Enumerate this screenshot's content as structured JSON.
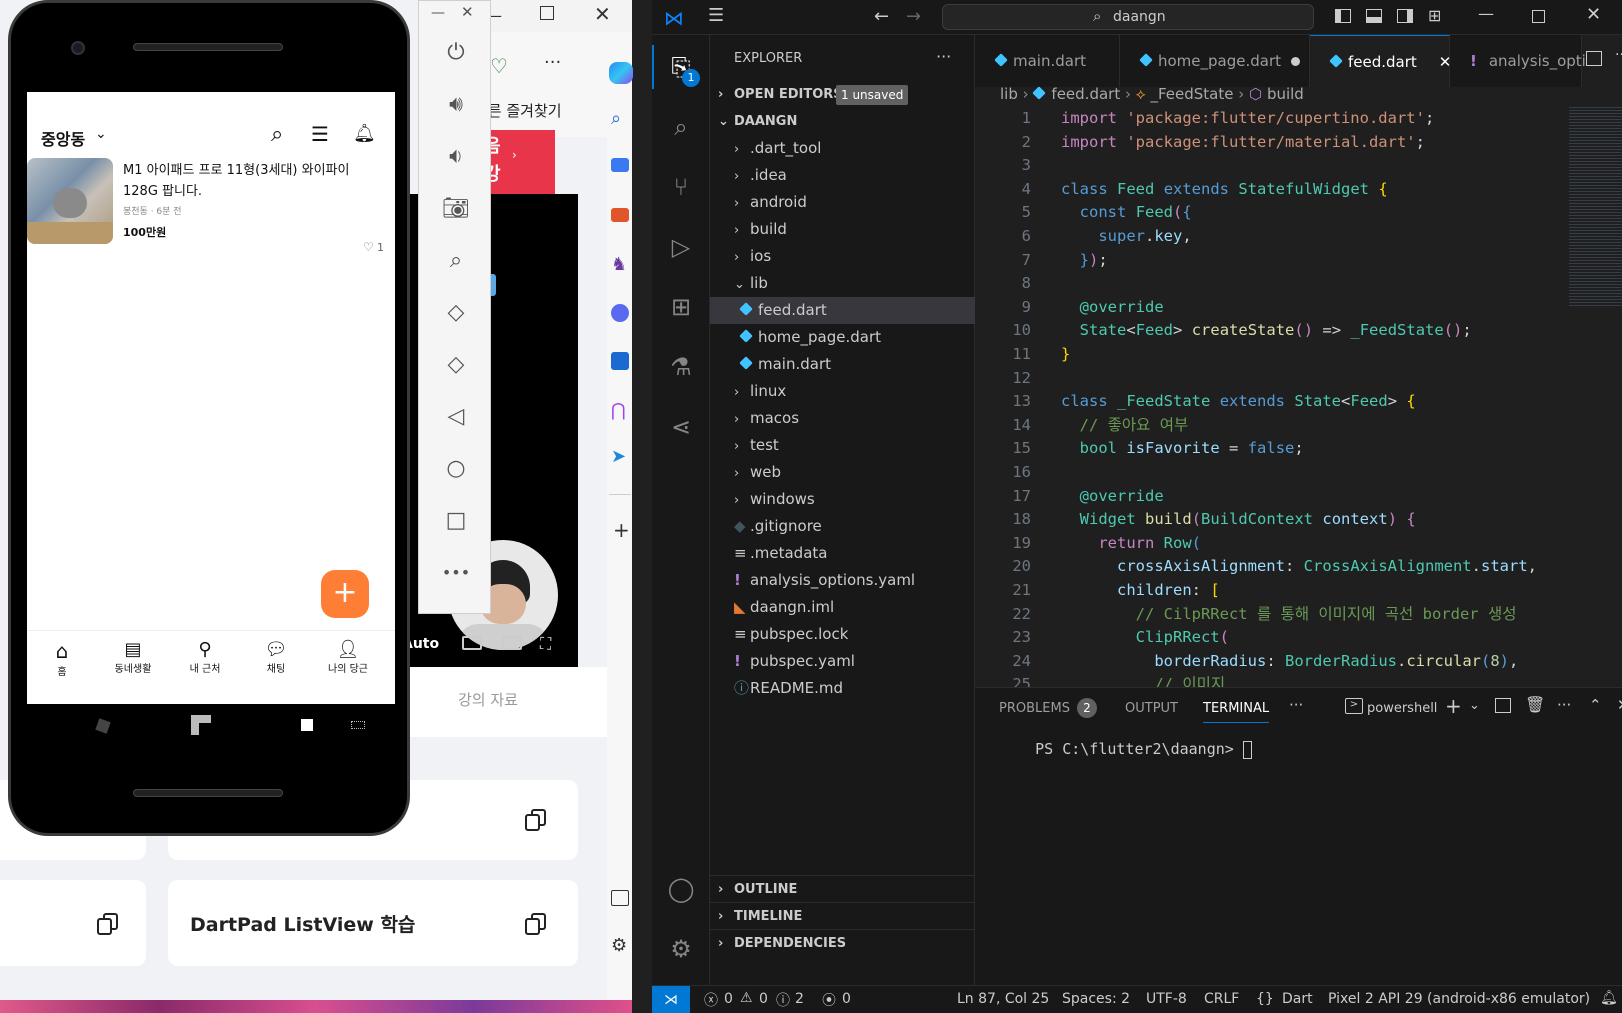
{
  "browser": {
    "favorites_text": "다른 즐겨찾기",
    "banner_top": "음",
    "banner_bottom": "강",
    "video_auto": "Auto",
    "course_materials": "강의 자료",
    "card_dartpad": "DartPad ListView 학습",
    "more_label": "···"
  },
  "phone": {
    "location": "중앙동",
    "item": {
      "title": "M1 아이패드 프로 11형(3세대) 와이파이 128G 팝니다.",
      "meta": "봉천동 · 6분 전",
      "price": "100만원",
      "likes": "1"
    },
    "fab": "+",
    "nav": [
      {
        "label": "홈"
      },
      {
        "label": "동네생활"
      },
      {
        "label": "내 근처"
      },
      {
        "label": "채팅"
      },
      {
        "label": "나의 당근"
      }
    ]
  },
  "emulator_toolbar": [
    "power",
    "volume-up",
    "volume-down",
    "camera",
    "zoom",
    "rotate-left",
    "rotate-right",
    "back",
    "home",
    "overview",
    "more"
  ],
  "vscode": {
    "search": "daangn",
    "explorer_title": "EXPLORER",
    "open_editors": "OPEN EDITORS",
    "unsaved_badge": "1 unsaved",
    "project": "DAANGN",
    "tree": [
      {
        "name": ".dart_tool",
        "type": "folder",
        "depth": 1
      },
      {
        "name": ".idea",
        "type": "folder",
        "depth": 1
      },
      {
        "name": "android",
        "type": "folder",
        "depth": 1
      },
      {
        "name": "build",
        "type": "folder",
        "depth": 1
      },
      {
        "name": "ios",
        "type": "folder",
        "depth": 1
      },
      {
        "name": "lib",
        "type": "folder-open",
        "depth": 1
      },
      {
        "name": "feed.dart",
        "type": "dart",
        "depth": 2
      },
      {
        "name": "home_page.dart",
        "type": "dart",
        "depth": 2
      },
      {
        "name": "main.dart",
        "type": "dart",
        "depth": 2
      },
      {
        "name": "linux",
        "type": "folder",
        "depth": 1
      },
      {
        "name": "macos",
        "type": "folder",
        "depth": 1
      },
      {
        "name": "test",
        "type": "folder",
        "depth": 1
      },
      {
        "name": "web",
        "type": "folder",
        "depth": 1
      },
      {
        "name": "windows",
        "type": "folder",
        "depth": 1
      },
      {
        "name": ".gitignore",
        "type": "git",
        "depth": 1
      },
      {
        "name": ".metadata",
        "type": "lines",
        "depth": 1
      },
      {
        "name": "analysis_options.yaml",
        "type": "yaml",
        "depth": 1
      },
      {
        "name": "daangn.iml",
        "type": "rss",
        "depth": 1
      },
      {
        "name": "pubspec.lock",
        "type": "lines",
        "depth": 1
      },
      {
        "name": "pubspec.yaml",
        "type": "yaml",
        "depth": 1
      },
      {
        "name": "README.md",
        "type": "info",
        "depth": 1
      }
    ],
    "outline": "OUTLINE",
    "timeline": "TIMELINE",
    "dependencies": "DEPENDENCIES",
    "tabs": [
      {
        "label": "main.dart"
      },
      {
        "label": "home_page.dart"
      },
      {
        "label": "feed.dart"
      },
      {
        "label": "analysis_opti"
      }
    ],
    "breadcrumb": [
      "lib",
      "feed.dart",
      "_FeedState",
      "build"
    ],
    "code_lines": [
      {
        "n": "1",
        "html": "<span class='p'>import</span> <span class='s'>'package:flutter/cupertino.dart'</span><span class='w'>;</span>"
      },
      {
        "n": "2",
        "html": "<span class='p'>import</span> <span class='s'>'package:flutter/material.dart'</span><span class='w'>;</span>"
      },
      {
        "n": "3",
        "html": ""
      },
      {
        "n": "4",
        "html": "<span class='k'>class</span> <span class='t'>Feed</span> <span class='k'>extends</span> <span class='t'>StatefulWidget</span> <span class='y'>{</span>"
      },
      {
        "n": "5",
        "html": "  <span class='k'>const</span> <span class='t'>Feed</span><span class='p'>(</span><span class='k'>{</span>"
      },
      {
        "n": "6",
        "html": "    <span class='k'>super</span><span class='w'>.</span><span class='v'>key</span><span class='w'>,</span>"
      },
      {
        "n": "7",
        "html": "  <span class='k'>}</span><span class='p'>)</span><span class='w'>;</span>"
      },
      {
        "n": "8",
        "html": ""
      },
      {
        "n": "9",
        "html": "  <span class='t'>@override</span>"
      },
      {
        "n": "10",
        "html": "  <span class='t'>State</span><span class='w'>&lt;</span><span class='t'>Feed</span><span class='w'>&gt;</span> <span class='f'>createState</span><span class='p'>()</span> <span class='w'>=&gt;</span> <span class='t'>_FeedState</span><span class='p'>()</span><span class='w'>;</span>"
      },
      {
        "n": "11",
        "html": "<span class='y'>}</span>"
      },
      {
        "n": "12",
        "html": ""
      },
      {
        "n": "13",
        "html": "<span class='k'>class</span> <span class='t'>_FeedState</span> <span class='k'>extends</span> <span class='t'>State</span><span class='w'>&lt;</span><span class='t'>Feed</span><span class='w'>&gt;</span> <span class='y'>{</span>"
      },
      {
        "n": "14",
        "html": "  <span class='c'>// 좋아요 여부</span>"
      },
      {
        "n": "15",
        "html": "  <span class='t'>bool</span> <span class='v'>isFavorite</span> <span class='w'>=</span> <span class='k'>false</span><span class='w'>;</span>"
      },
      {
        "n": "16",
        "html": ""
      },
      {
        "n": "17",
        "html": "  <span class='t'>@override</span>"
      },
      {
        "n": "18",
        "html": "  <span class='t'>Widget</span> <span class='f'>build</span><span class='p'>(</span><span class='t'>BuildContext</span> <span class='v'>context</span><span class='p'>)</span> <span class='p'>{</span>"
      },
      {
        "n": "19",
        "html": "    <span class='p'>return</span> <span class='t'>Row</span><span class='k'>(</span>"
      },
      {
        "n": "20",
        "html": "      <span class='v'>crossAxisAlignment</span><span class='w'>:</span> <span class='t'>CrossAxisAlignment</span><span class='w'>.</span><span class='v'>start</span><span class='w'>,</span>"
      },
      {
        "n": "21",
        "html": "      <span class='v'>children</span><span class='w'>:</span> <span class='y'>[</span>"
      },
      {
        "n": "22",
        "html": "        <span class='c'>// CilpRRect 를 통해 이미지에 곡선 border 생성</span>"
      },
      {
        "n": "23",
        "html": "        <span class='t'>ClipRRect</span><span class='p'>(</span>"
      },
      {
        "n": "24",
        "html": "          <span class='v'>borderRadius</span><span class='w'>:</span> <span class='t'>BorderRadius</span><span class='w'>.</span><span class='f'>circular</span><span class='k'>(</span><span class='n'>8</span><span class='k'>)</span><span class='w'>,</span>"
      },
      {
        "n": "25",
        "html": "          <span class='c'>// 이미지</span>"
      }
    ],
    "panel": {
      "problems": "PROBLEMS",
      "problems_count": "2",
      "output": "OUTPUT",
      "terminal": "TERMINAL",
      "more": "···",
      "shell": "powershell",
      "prompt": "PS C:\\flutter2\\daangn> "
    },
    "status": {
      "errors": "0",
      "warnings": "0",
      "infos": "2",
      "ports": "0",
      "position": "Ln 87, Col 25",
      "spaces": "Spaces: 2",
      "encoding": "UTF-8",
      "eol": "CRLF",
      "language": "Dart",
      "device": "Pixel 2 API 29 (android-x86 emulator)"
    },
    "activity_badge": "1"
  },
  "colors": {
    "accent_orange": "#ff7e36",
    "vscode_blue": "#0078d4",
    "dart": "#40c4ff"
  }
}
